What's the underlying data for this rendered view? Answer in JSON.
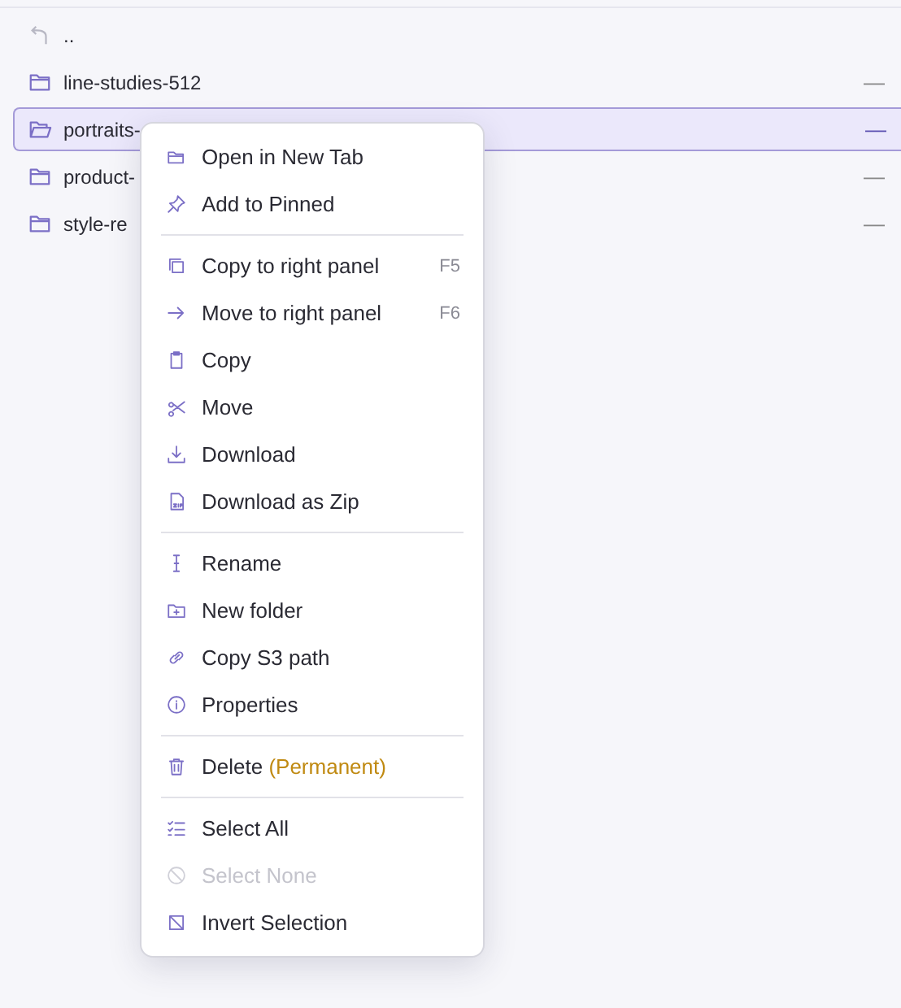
{
  "files": [
    {
      "kind": "parent",
      "name": "..",
      "selected": false
    },
    {
      "kind": "folder",
      "name": "line-studies-512",
      "column_2": "—",
      "selected": false
    },
    {
      "kind": "folder",
      "name": "portraits-",
      "column_2": "—",
      "selected": true
    },
    {
      "kind": "folder",
      "name": "product-",
      "column_2": "—",
      "selected": false
    },
    {
      "kind": "folder",
      "name": "style-re",
      "column_2": "—",
      "selected": false
    }
  ],
  "context_menu": [
    {
      "kind": "item",
      "label": "Open in New Tab",
      "disabled": false
    },
    {
      "kind": "item",
      "label": "Add to Pinned",
      "disabled": false
    },
    {
      "kind": "separator"
    },
    {
      "kind": "item",
      "label": "Copy to right panel",
      "shortcut": "F5",
      "disabled": false
    },
    {
      "kind": "item",
      "label": "Move to right panel",
      "shortcut": "F6",
      "disabled": false
    },
    {
      "kind": "item",
      "label": "Copy",
      "disabled": false
    },
    {
      "kind": "item",
      "label": "Move",
      "disabled": false
    },
    {
      "kind": "item",
      "label": "Download",
      "disabled": false
    },
    {
      "kind": "item",
      "label": "Download as Zip",
      "disabled": false
    },
    {
      "kind": "separator"
    },
    {
      "kind": "item",
      "label": "Rename",
      "disabled": false
    },
    {
      "kind": "item",
      "label": "New folder",
      "disabled": false
    },
    {
      "kind": "item",
      "label": "Copy S3 path",
      "disabled": false
    },
    {
      "kind": "item",
      "label": "Properties",
      "disabled": false
    },
    {
      "kind": "separator"
    },
    {
      "kind": "item",
      "label": "Delete",
      "note": "(Permanent)",
      "disabled": false
    },
    {
      "kind": "separator"
    },
    {
      "kind": "item",
      "label": "Select All",
      "disabled": false
    },
    {
      "kind": "item",
      "label": "Select None",
      "disabled": true
    },
    {
      "kind": "item",
      "label": "Invert Selection",
      "disabled": false
    }
  ]
}
